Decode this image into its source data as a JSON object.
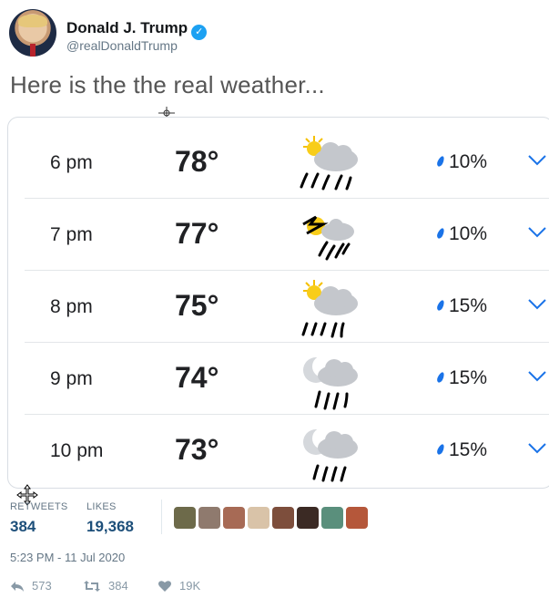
{
  "tweet": {
    "author_name": "Donald J. Trump",
    "verified_mark": "✓",
    "handle": "@realDonaldTrump",
    "text": "Here is the the real weather..."
  },
  "forecast": {
    "rows": [
      {
        "time": "6 pm",
        "temp": "78°",
        "icon": "sun-cloud-rain-icon",
        "precip": "10%"
      },
      {
        "time": "7 pm",
        "temp": "77°",
        "icon": "sun-cloud-rain-icon",
        "precip": "10%"
      },
      {
        "time": "8 pm",
        "temp": "75°",
        "icon": "sun-cloud-rain-icon",
        "precip": "15%"
      },
      {
        "time": "9 pm",
        "temp": "74°",
        "icon": "moon-cloud-rain-icon",
        "precip": "15%"
      },
      {
        "time": "10 pm",
        "temp": "73°",
        "icon": "moon-cloud-rain-icon",
        "precip": "15%"
      }
    ]
  },
  "stats": {
    "retweets_label": "RETWEETS",
    "retweets_count": "384",
    "likes_label": "LIKES",
    "likes_count": "19,368"
  },
  "date": "5:23 PM - 11 Jul 2020",
  "actions": {
    "reply_count": "573",
    "retweet_count": "384",
    "like_count": "19K"
  },
  "colors": {
    "accent": "#1da1f2",
    "drop": "#1a73e8",
    "chevron": "#1a73e8",
    "stat_value": "#1d4f7a"
  }
}
